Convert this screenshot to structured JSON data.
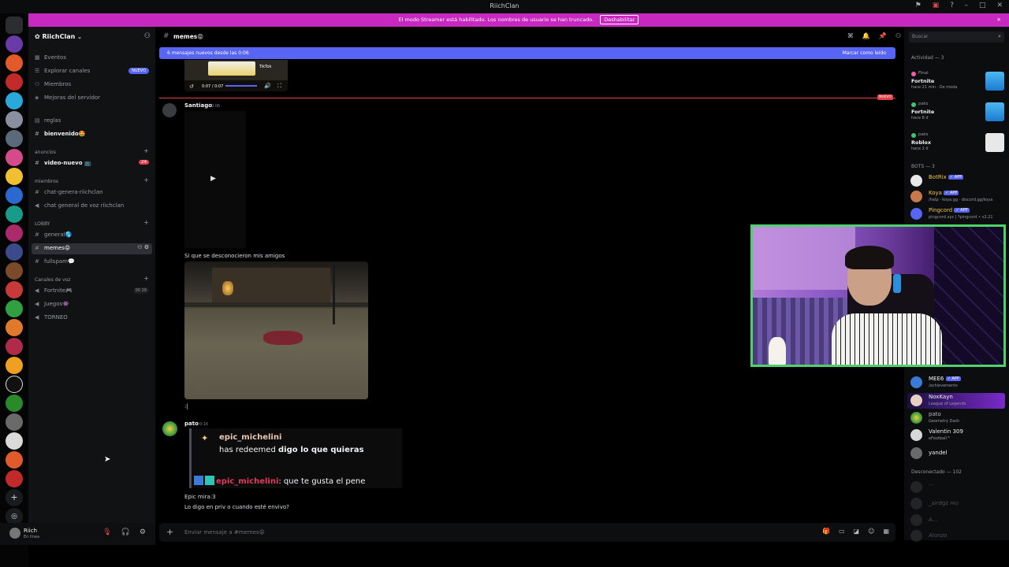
{
  "window": {
    "title": "RiichClan"
  },
  "banner": {
    "text": "El modo Streamer está habilitado. Los nombres de usuario se han truncado.",
    "button": "Deshabilitar"
  },
  "server": {
    "name": "RiichClan"
  },
  "sidebar": {
    "top_items": [
      {
        "label": "Eventos"
      },
      {
        "label": "Explorar canales",
        "badge": "NUEVO"
      },
      {
        "label": "Miembros"
      },
      {
        "label": "Mejoras del servidor"
      }
    ],
    "channels": {
      "reglas": "reglas",
      "bienvenido": "bienvenido🤩",
      "cat_anuncios": "anuncios",
      "video_nuevo": "video-nuevo 📺",
      "video_nuevo_badge": "24",
      "cat_miembros": "miembros",
      "chat_genera": "chat-genera-riichclan",
      "chat_voz": "chat general de voz riichclan",
      "cat_lobby": "LOBBY",
      "general": "general🌎",
      "memes": "memes😝",
      "fullspam": "fullspam💬",
      "cat_voz": "Canales de voz",
      "fortnite": "Fortnite🎮",
      "fortnite_count": "00 29",
      "juegos": "Juegos👾",
      "torneo": "TORNEO"
    }
  },
  "user": {
    "name": "Riich",
    "status": "En línea"
  },
  "chat": {
    "channel_name": "memes😝",
    "new_bar_left": "6 mensajes nuevos desde las 0:06",
    "new_bar_right": "Marcar como leído",
    "video_time": "0:07 / 0:07",
    "video_tiktok": "TikTok",
    "new_tag": "NUEVO",
    "messages": [
      {
        "author": "Santiago",
        "time": "0:06"
      },
      {
        "text": "Si que se desconocieron mis amigos"
      },
      {
        "text": ":|"
      },
      {
        "author": "pato",
        "time": "0:16"
      }
    ],
    "embed": {
      "name": "epic_michelini",
      "desc_prefix": "has redeemed ",
      "desc_bold": "digo lo que quieras",
      "twitch_name": "epic_michelini",
      "twitch_msg": ": que te gusta el pene"
    },
    "last_lines": [
      "Epic mira:3",
      "Lo digo en priv o cuando esté envivo?"
    ],
    "composer_placeholder": "Enviar mensaje a #memes😝"
  },
  "right_panel": {
    "search_placeholder": "Buscar",
    "activity_title": "Actividad — 3",
    "activities": [
      {
        "user": "Final",
        "game": "Fortnite",
        "meta": "hace 21 min · De moda",
        "dot": "#f25ca8"
      },
      {
        "user": "pato",
        "game": "Fortnite",
        "meta": "hace 8 d",
        "dot": "#3ec46d"
      },
      {
        "user": "pato",
        "game": "Roblox",
        "meta": "hace 2 d",
        "dot": "#3ec46d"
      }
    ],
    "bots_title": "BOTS — 3",
    "bots": [
      {
        "name": "BotRix",
        "app": "✓ APP",
        "sub": "",
        "color": "#f2c744"
      },
      {
        "name": "Koya",
        "app": "✓ APP",
        "sub": "/help · koya.gg · discord.gg/koya",
        "color": "#f2c744"
      },
      {
        "name": "Pingcord",
        "app": "✓ APP",
        "sub": "pingcord.xyz | ?pingcord • v2.21",
        "color": "#f2c744"
      }
    ],
    "members": [
      {
        "name": "MEE6",
        "app": "✓ APP",
        "sub": "/achievements",
        "color": "#f2f3f5"
      },
      {
        "name": "NoxKayn",
        "app": "",
        "sub": "League of Legends",
        "color": "#f2f3f5"
      },
      {
        "name": "pato",
        "app": "",
        "sub": "Geometry Dash",
        "color": "#b5bac1"
      },
      {
        "name": "Valentin 309",
        "app": "",
        "sub": "eFootball™",
        "color": "#f2f3f5"
      },
      {
        "name": "yandel",
        "app": "",
        "sub": "",
        "color": "#f2f3f5"
      }
    ],
    "offline_title": "Desconectado — 102",
    "offline": [
      {
        "name": "...",
        "sub": ""
      },
      {
        "name": "_airdgz",
        "sub": "PRO"
      },
      {
        "name": "A...",
        "sub": ""
      },
      {
        "name": "Alonzo",
        "sub": ""
      }
    ]
  },
  "colors": {
    "accent": "#5865f2",
    "banner": "#c729c0",
    "webcam_border": "#4cd36b",
    "new_divider": "#e8404a"
  }
}
